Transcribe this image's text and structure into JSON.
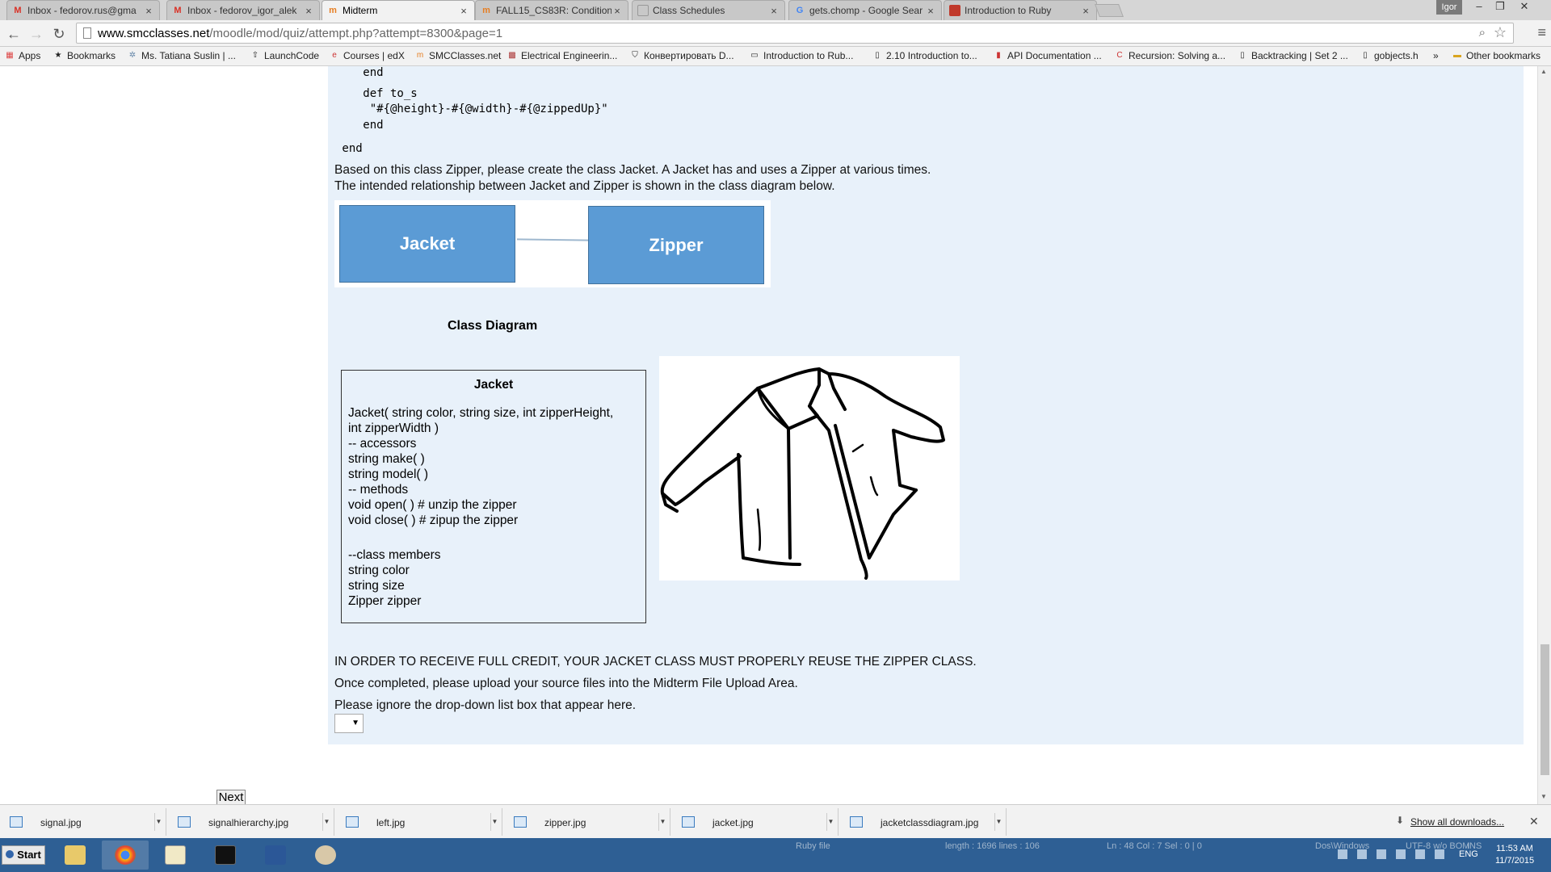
{
  "browser": {
    "tabs": [
      {
        "title": "Inbox - fedorov.rus@gma",
        "icon": "gmail-icon",
        "active": false
      },
      {
        "title": "Inbox - fedorov_igor_alek",
        "icon": "gmail-icon",
        "active": false
      },
      {
        "title": "Midterm",
        "icon": "moodle-icon",
        "active": true
      },
      {
        "title": "FALL15_CS83R: Condition",
        "icon": "moodle-icon",
        "active": false
      },
      {
        "title": "Class Schedules",
        "icon": "page-icon",
        "active": false
      },
      {
        "title": "gets.chomp - Google Sear",
        "icon": "google-icon",
        "active": false
      },
      {
        "title": "Introduction to Ruby",
        "icon": "ruby-icon",
        "active": false
      }
    ],
    "user_badge": "Igor",
    "url_domain": "www.smcclasses.net",
    "url_path": "/moodle/mod/quiz/attempt.php?attempt=8300&page=1",
    "bookmarks": [
      "Apps",
      "Bookmarks",
      "Ms. Tatiana Suslin | ...",
      "LaunchCode",
      "Courses | edX",
      "SMCClasses.net",
      "Electrical Engineerin...",
      "Конвертировать D...",
      "Introduction to Rub...",
      "2.10 Introduction to...",
      "API Documentation ...",
      "Recursion: Solving a...",
      "Backtracking | Set 2 ...",
      "gobjects.h",
      "»",
      "Other bookmarks"
    ]
  },
  "page": {
    "code_lines": [
      "   end",
      "",
      "   def to_s",
      "    \"#{@height}-#{@width}-#{@zippedUp}\"",
      "   end",
      " end"
    ],
    "intro_line1": "Based on this class Zipper, please create the class Jacket.  A Jacket has and uses a Zipper at various times.",
    "intro_line2": "The intended relationship between Jacket and Zipper is shown in the class diagram below.",
    "diagram": {
      "left_box": "Jacket",
      "right_box": "Zipper"
    },
    "diagram_caption": "Class Diagram",
    "jacket_class": {
      "title": "Jacket",
      "lines_a": [
        "Jacket( string color, string size, int zipperHeight,",
        "int zipperWidth )",
        "-- accessors",
        "string make( )",
        "string model( )",
        "-- methods",
        "void open( ) # unzip the zipper",
        "void close( ) # zipup the zipper"
      ],
      "lines_b": [
        "--class members",
        "string color",
        "string size",
        "Zipper zipper"
      ]
    },
    "credit_note": "IN ORDER TO RECEIVE FULL CREDIT, YOUR JACKET CLASS MUST PROPERLY REUSE THE ZIPPER CLASS.",
    "upload_note": "Once completed, please upload your source files into the Midterm File Upload Area.",
    "ignore_note": "Please ignore the drop-down list box that appear here.",
    "next_label": "Next"
  },
  "downloads": {
    "items": [
      "signal.jpg",
      "signalhierarchy.jpg",
      "left.jpg",
      "zipper.jpg",
      "jacket.jpg",
      "jacketclassdiagram.jpg"
    ],
    "show_all": "Show all downloads..."
  },
  "taskbar": {
    "start": "Start",
    "status_items": [
      "Ruby file",
      "length : 1696    lines : 106",
      "Ln : 48    Col : 7    Sel : 0 | 0",
      "Dos\\Windows",
      "UTF-8 w/o BOM",
      "INS"
    ],
    "language": "ENG",
    "time": "11:53 AM",
    "date": "11/7/2015"
  },
  "colors": {
    "content_bg": "#e8f1fa",
    "uml_box": "#5b9bd5",
    "taskbar": "#2e5f94"
  }
}
